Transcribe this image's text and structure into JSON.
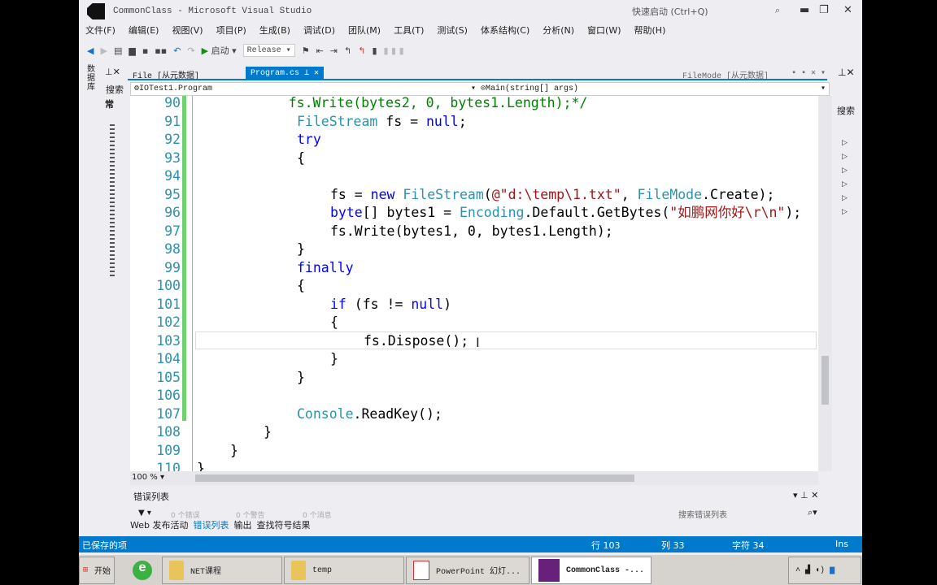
{
  "window": {
    "title": "CommonClass - Microsoft Visual Studio",
    "quick_launch": "快速启动 (Ctrl+Q)"
  },
  "menu": [
    "文件(F)",
    "编辑(E)",
    "视图(V)",
    "项目(P)",
    "生成(B)",
    "调试(D)",
    "团队(M)",
    "工具(T)",
    "测试(S)",
    "体系结构(C)",
    "分析(N)",
    "窗口(W)",
    "帮助(H)"
  ],
  "toolbar": {
    "start": "启动",
    "config": "Release"
  },
  "left_panel": {
    "search": "搜索",
    "tab": "常",
    "vertical": "数据库"
  },
  "tabs": {
    "file": "File [从元数据]",
    "program": "Program.cs",
    "filemode": "FileMode [从元数据]"
  },
  "nav": {
    "class": "IOTest1.Program",
    "member": "Main(string[] args)"
  },
  "right_panel": {
    "search": "搜索"
  },
  "code": [
    {
      "n": "90",
      "i": 11,
      "t": [
        [
          "cm",
          "fs.Write(bytes2, 0, bytes1.Length);*/"
        ]
      ]
    },
    {
      "n": "91",
      "i": 12,
      "t": [
        [
          "ty",
          "FileStream"
        ],
        [
          "pl",
          " fs = "
        ],
        [
          "kw",
          "null"
        ],
        [
          "pl",
          ";"
        ]
      ]
    },
    {
      "n": "92",
      "i": 12,
      "t": [
        [
          "kw",
          "try"
        ]
      ]
    },
    {
      "n": "93",
      "i": 12,
      "t": [
        [
          "pl",
          "{"
        ]
      ]
    },
    {
      "n": "94",
      "i": 0,
      "t": []
    },
    {
      "n": "95",
      "i": 16,
      "t": [
        [
          "pl",
          "fs = "
        ],
        [
          "kw",
          "new"
        ],
        [
          "pl",
          " "
        ],
        [
          "ty",
          "FileStream"
        ],
        [
          "pl",
          "("
        ],
        [
          "st",
          "@\"d:\\temp\\1.txt\""
        ],
        [
          "pl",
          ", "
        ],
        [
          "ty",
          "FileMode"
        ],
        [
          "pl",
          ".Create);"
        ]
      ]
    },
    {
      "n": "96",
      "i": 16,
      "t": [
        [
          "kw",
          "byte"
        ],
        [
          "pl",
          "[] bytes1 = "
        ],
        [
          "ty",
          "Encoding"
        ],
        [
          "pl",
          ".Default.GetBytes("
        ],
        [
          "st",
          "\"如鹏网你好\\r\\n\""
        ],
        [
          "pl",
          ");"
        ]
      ]
    },
    {
      "n": "97",
      "i": 16,
      "t": [
        [
          "pl",
          "fs.Write(bytes1, 0, bytes1.Length);"
        ]
      ]
    },
    {
      "n": "98",
      "i": 12,
      "t": [
        [
          "pl",
          "}"
        ]
      ]
    },
    {
      "n": "99",
      "i": 12,
      "t": [
        [
          "kw",
          "finally"
        ]
      ]
    },
    {
      "n": "100",
      "i": 12,
      "t": [
        [
          "pl",
          "{"
        ]
      ]
    },
    {
      "n": "101",
      "i": 16,
      "t": [
        [
          "kw",
          "if"
        ],
        [
          "pl",
          " (fs != "
        ],
        [
          "kw",
          "null"
        ],
        [
          "pl",
          ")"
        ]
      ]
    },
    {
      "n": "102",
      "i": 16,
      "t": [
        [
          "pl",
          "{"
        ]
      ]
    },
    {
      "n": "103",
      "i": 20,
      "t": [
        [
          "pl",
          "fs.Dispose();"
        ]
      ]
    },
    {
      "n": "104",
      "i": 16,
      "t": [
        [
          "pl",
          "}"
        ]
      ]
    },
    {
      "n": "105",
      "i": 12,
      "t": [
        [
          "pl",
          "}"
        ]
      ]
    },
    {
      "n": "106",
      "i": 0,
      "t": []
    },
    {
      "n": "107",
      "i": 12,
      "t": [
        [
          "ty",
          "Console"
        ],
        [
          "pl",
          ".ReadKey();"
        ]
      ]
    },
    {
      "n": "108",
      "i": 8,
      "t": [
        [
          "pl",
          "}"
        ]
      ]
    },
    {
      "n": "109",
      "i": 4,
      "t": [
        [
          "pl",
          "}"
        ]
      ]
    },
    {
      "n": "110",
      "i": 0,
      "t": [
        [
          "pl",
          "}"
        ]
      ]
    }
  ],
  "zoom": "100 %",
  "error_list": {
    "title": "错误列表",
    "errors": "0 个错误",
    "warnings": "0 个警告",
    "messages": "0 个消息",
    "search": "搜索错误列表",
    "tabs": [
      "Web 发布活动",
      "错误列表",
      "输出",
      "查找符号结果"
    ]
  },
  "status": {
    "text": "已保存的项",
    "line": "行 103",
    "col": "列 33",
    "ch": "字符 34",
    "mode": "Ins"
  },
  "taskbar": {
    "start": "开始",
    "items": [
      "NET课程",
      "temp",
      "PowerPoint 幻灯...",
      "CommonClass -..."
    ]
  },
  "colors": {
    "accent": "#007acc"
  }
}
